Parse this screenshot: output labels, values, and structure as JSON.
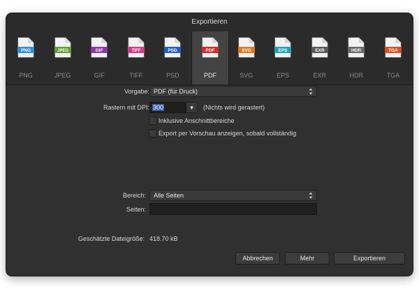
{
  "window": {
    "title": "Exportieren"
  },
  "formats": [
    {
      "badge": "PNG",
      "name": "PNG",
      "color": "#2f8fd8",
      "selected": false
    },
    {
      "badge": "JPEG",
      "name": "JPEG",
      "color": "#5ea033",
      "selected": false
    },
    {
      "badge": "GIF",
      "name": "GIF",
      "color": "#8a3aa8",
      "selected": false
    },
    {
      "badge": "TIFF",
      "name": "TIFF",
      "color": "#d63a8c",
      "selected": false
    },
    {
      "badge": "PSD",
      "name": "PSD",
      "color": "#1f5fc8",
      "selected": false
    },
    {
      "badge": "PDF",
      "name": "PDF",
      "color": "#d42b2b",
      "selected": true
    },
    {
      "badge": "SVG",
      "name": "SVG",
      "color": "#e0791c",
      "selected": false
    },
    {
      "badge": "EPS",
      "name": "EPS",
      "color": "#22a3b8",
      "selected": false
    },
    {
      "badge": "EXR",
      "name": "EXR",
      "color": "#5a5a5a",
      "selected": false
    },
    {
      "badge": "HDR",
      "name": "HDR",
      "color": "#6a6a6a",
      "selected": false
    },
    {
      "badge": "TGA",
      "name": "TGA",
      "color": "#d9531e",
      "selected": false
    }
  ],
  "preset": {
    "label": "Vorgabe:",
    "value": "PDF (für Druck)"
  },
  "raster": {
    "label": "Rastern mit DPI:",
    "value": "300",
    "note": "(Nichts wird gerastert)",
    "dropdown_glyph": "▾"
  },
  "bleed": {
    "label": "Inklusive Anschnittbereiche",
    "checked": false
  },
  "preview": {
    "label": "Export per Vorschau anzeigen, sobald vollständig",
    "checked": false
  },
  "range": {
    "label": "Bereich:",
    "value": "Alle Seiten"
  },
  "pages": {
    "label": "Seiten:",
    "value": ""
  },
  "filesize": {
    "label": "Geschätzte Dateigröße:",
    "value": "418.70 kB"
  },
  "buttons": {
    "cancel": "Abbrechen",
    "more": "Mehr",
    "export": "Exportieren"
  }
}
